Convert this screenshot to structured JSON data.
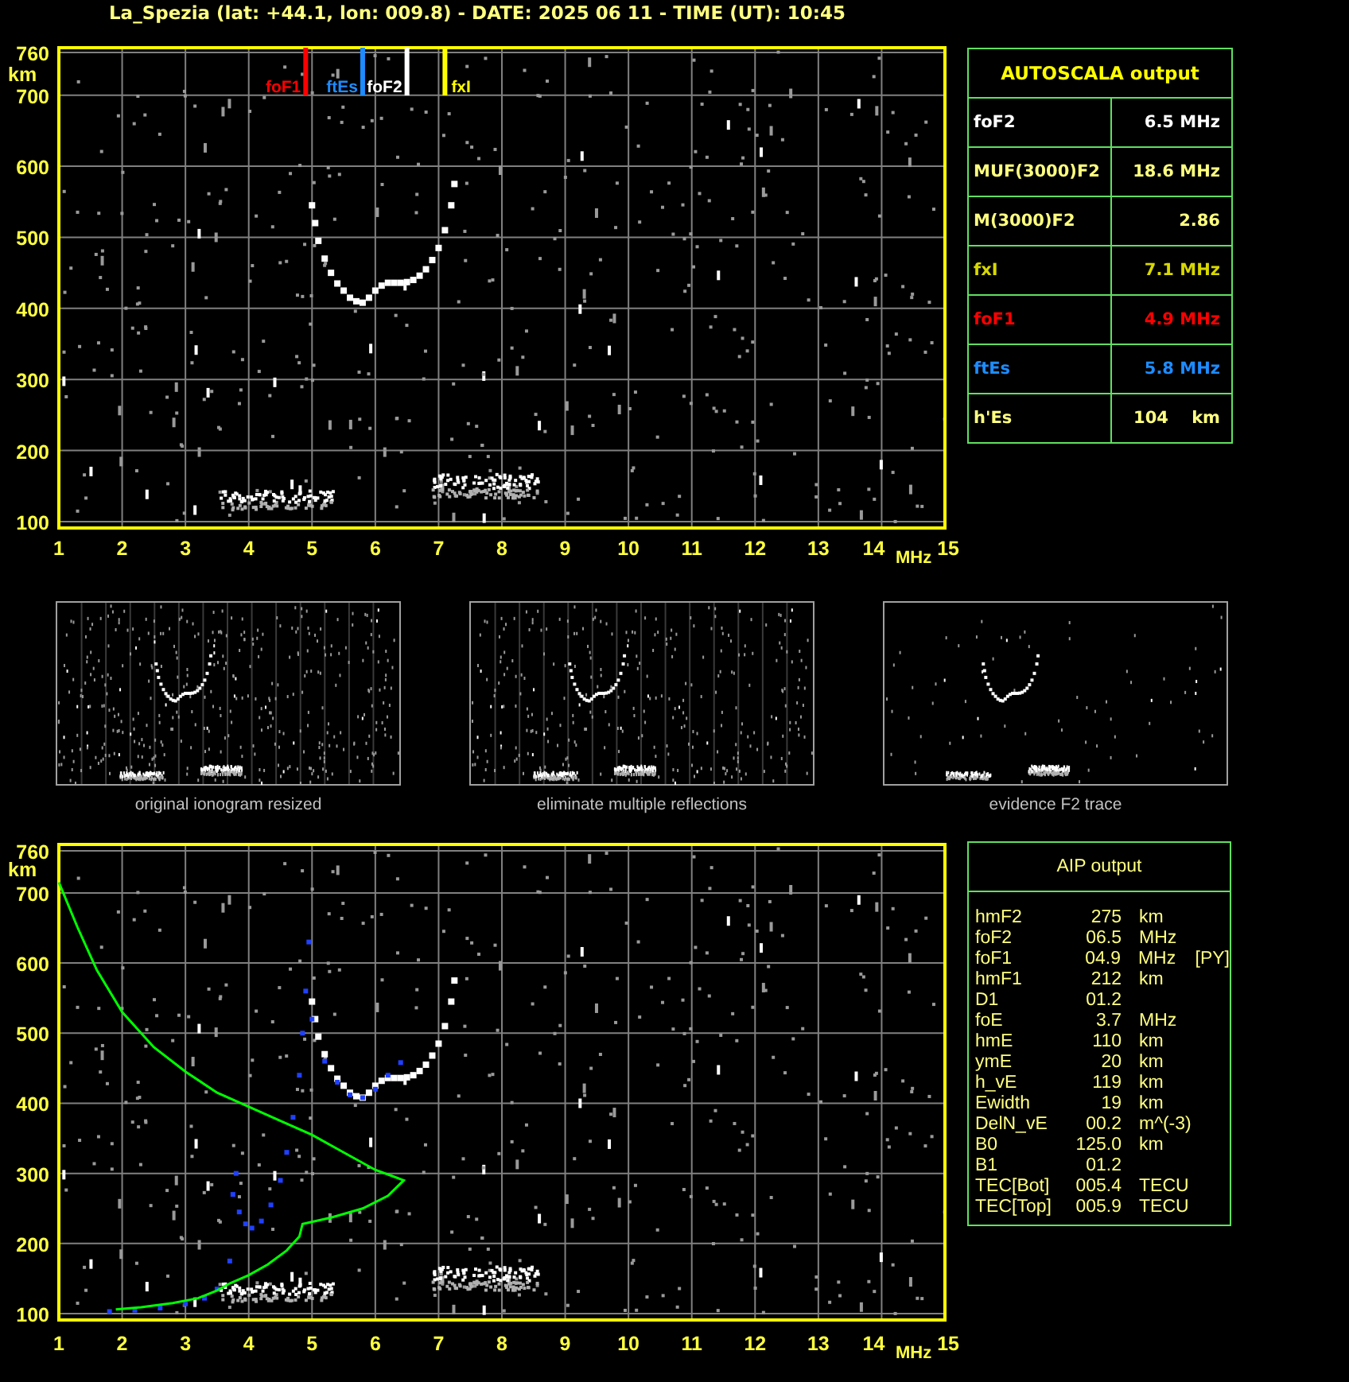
{
  "title": "La_Spezia (lat: +44.1, lon: 009.8) - DATE: 2025 06 11 - TIME (UT): 10:45",
  "ionogram": {
    "y_ticks": [
      "760",
      "700",
      "600",
      "500",
      "400",
      "300",
      "200",
      "100"
    ],
    "y_unit": "km",
    "x_ticks": [
      "1",
      "2",
      "3",
      "4",
      "5",
      "6",
      "7",
      "8",
      "9",
      "10",
      "11",
      "12",
      "13",
      "14",
      "15"
    ],
    "x_unit": "MHz",
    "markers": [
      {
        "label": "foF1",
        "color": "#ff0000"
      },
      {
        "label": "ftEs",
        "color": "#1e8cff"
      },
      {
        "label": "foF2",
        "color": "#ffffff"
      },
      {
        "label": "fxI",
        "color": "#ffff00"
      }
    ]
  },
  "autoscala": {
    "title": "AUTOSCALA output",
    "rows": [
      {
        "label": "foF2",
        "value": "6.5 MHz",
        "color": "#ffffff"
      },
      {
        "label": "MUF(3000)F2",
        "value": "18.6 MHz",
        "color": "#ffff80"
      },
      {
        "label": "M(3000)F2",
        "value": "2.86",
        "color": "#ffff80"
      },
      {
        "label": "fxI",
        "value": "7.1 MHz",
        "color": "#d8d800"
      },
      {
        "label": "foF1",
        "value": "4.9 MHz",
        "color": "#ff0000"
      },
      {
        "label": "ftEs",
        "value": "5.8 MHz",
        "color": "#1e8cff"
      },
      {
        "label": "h'Es",
        "value": "104    km",
        "color": "#ffff80"
      }
    ]
  },
  "thumbnails": [
    {
      "caption": "original ionogram resized",
      "kind": "original"
    },
    {
      "caption": "eliminate multiple reflections",
      "kind": "filtered"
    },
    {
      "caption": "evidence F2 trace",
      "kind": "f2"
    }
  ],
  "aip_ionogram": {
    "y_ticks": [
      "760",
      "700",
      "600",
      "500",
      "400",
      "300",
      "200",
      "100"
    ],
    "y_unit": "km",
    "x_ticks": [
      "1",
      "2",
      "3",
      "4",
      "5",
      "6",
      "7",
      "8",
      "9",
      "10",
      "11",
      "12",
      "13",
      "14",
      "15"
    ],
    "x_unit": "MHz"
  },
  "aip": {
    "title": "AIP output",
    "rows": [
      {
        "name": "hmF2",
        "value": "275",
        "unit": "km"
      },
      {
        "name": "foF2",
        "value": "06.5",
        "unit": "MHz"
      },
      {
        "name": "foF1",
        "value": "04.9",
        "unit": "MHz",
        "note": "[PY]"
      },
      {
        "name": "hmF1",
        "value": "212",
        "unit": "km"
      },
      {
        "name": "D1",
        "value": "01.2"
      },
      {
        "name": "foE",
        "value": "3.7",
        "unit": "MHz"
      },
      {
        "name": "hmE",
        "value": "110",
        "unit": "km"
      },
      {
        "name": "ymE",
        "value": "20",
        "unit": "km"
      },
      {
        "name": "h_vE",
        "value": "119",
        "unit": "km"
      },
      {
        "name": "Ewidth",
        "value": "19",
        "unit": "km"
      },
      {
        "name": "DelN_vE",
        "value": "00.2",
        "unit": "m^(-3)"
      },
      {
        "name": "B0",
        "value": "125.0",
        "unit": "km"
      },
      {
        "name": "B1",
        "value": "01.2"
      },
      {
        "name": "TEC[Bot]",
        "value": "005.4",
        "unit": "TECU"
      },
      {
        "name": "TEC[Top]",
        "value": "005.9",
        "unit": "TECU"
      }
    ]
  }
}
